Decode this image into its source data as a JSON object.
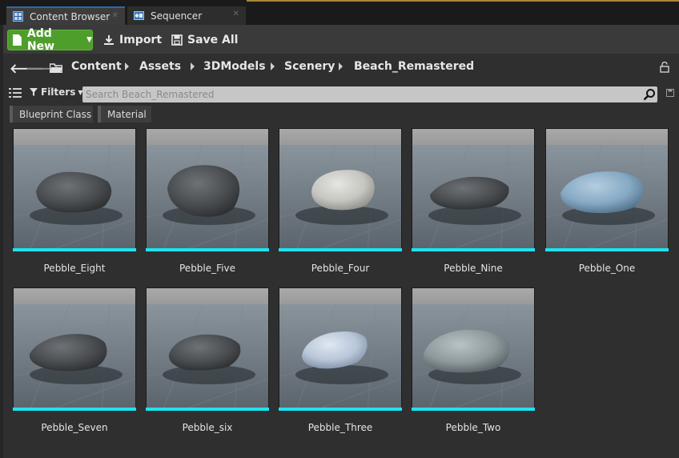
{
  "tabs": [
    {
      "label": "Content Browser",
      "icon": "content-browser-icon",
      "active": true
    },
    {
      "label": "Sequencer",
      "icon": "sequencer-icon",
      "active": false
    }
  ],
  "toolbar": {
    "add_new_label": "Add New",
    "import_label": "Import",
    "save_all_label": "Save All"
  },
  "breadcrumb": [
    "Content",
    "Assets",
    "3DModels",
    "Scenery",
    "Beach_Remastered"
  ],
  "search": {
    "filters_label": "Filters",
    "placeholder": "Search Beach_Remastered"
  },
  "filter_chips": [
    "Blueprint Class",
    "Material"
  ],
  "colors": {
    "accent_add": "#4e9e2c",
    "asset_bar": "#1ee3ee"
  },
  "assets": [
    {
      "name": "Pebble_Eight",
      "material": "gray"
    },
    {
      "name": "Pebble_Five",
      "material": "gray"
    },
    {
      "name": "Pebble_Four",
      "material": "white"
    },
    {
      "name": "Pebble_Nine",
      "material": "gray"
    },
    {
      "name": "Pebble_One",
      "material": "blue"
    },
    {
      "name": "Pebble_Seven",
      "material": "gray"
    },
    {
      "name": "Pebble_six",
      "material": "gray"
    },
    {
      "name": "Pebble_Three",
      "material": "lightblue"
    },
    {
      "name": "Pebble_Two",
      "material": "speckled"
    }
  ]
}
